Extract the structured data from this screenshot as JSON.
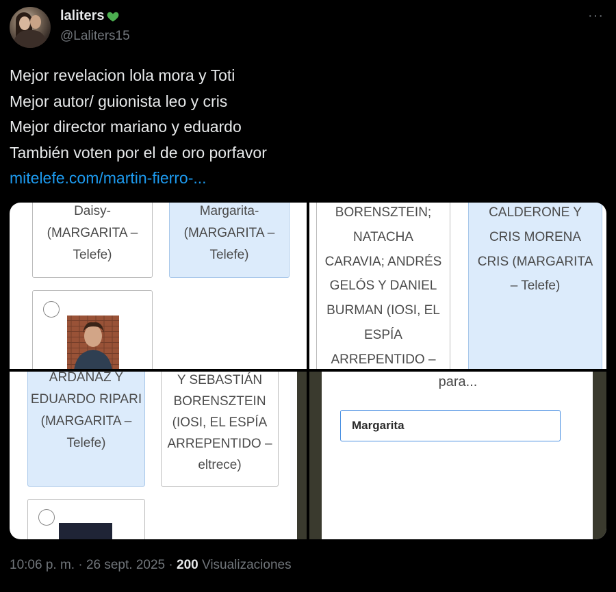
{
  "author": {
    "name": "laliters",
    "handle": "@Laliters15",
    "name_emoji": "green-heart-icon"
  },
  "tweet": {
    "lines": [
      "Mejor revelacion lola mora y Toti",
      "Mejor autor/ guionista leo y cris",
      "Mejor director mariano y eduardo",
      "También voten por el de oro porfavor"
    ],
    "link": "mitelefe.com/martin-fierro-..."
  },
  "media": {
    "q1": {
      "card_a": [
        "Daisy-",
        "(MARGARITA –",
        "Telefe)"
      ],
      "card_b": [
        "Margarita-",
        "(MARGARITA –",
        "Telefe)"
      ]
    },
    "q2": {
      "card_a": [
        "BORENSZTEIN;",
        "NATACHA",
        "CARAVIA; ANDRÉS",
        "GELÓS Y DANIEL",
        "BURMAN (IOSI, EL",
        "ESPÍA",
        "ARREPENTIDO –"
      ],
      "card_b": [
        "CALDERONE Y",
        "CRIS MORENA",
        "CRIS (MARGARITA",
        "– Telefe)"
      ]
    },
    "q3": {
      "card_a": [
        "ARDANAZ Y",
        "EDUARDO RIPARI",
        "(MARGARITA –",
        "Telefe)"
      ],
      "card_b": [
        "Y SEBASTIÁN",
        "BORENSZTEIN",
        "(IOSI, EL ESPÍA",
        "ARREPENTIDO –",
        "eltrece)"
      ]
    },
    "q4": {
      "search_line": "para...",
      "input_value": "Margarita"
    }
  },
  "meta": {
    "time": "10:06 p. m.",
    "date": "26 sept. 2025",
    "views_count": "200",
    "views_label": "Visualizaciones"
  },
  "colors": {
    "background": "#000000",
    "text": "#e7e9ea",
    "secondary": "#71767b",
    "link": "#1d9bf0",
    "selected_card": "#dcebfb",
    "heart": "#4caf50"
  }
}
